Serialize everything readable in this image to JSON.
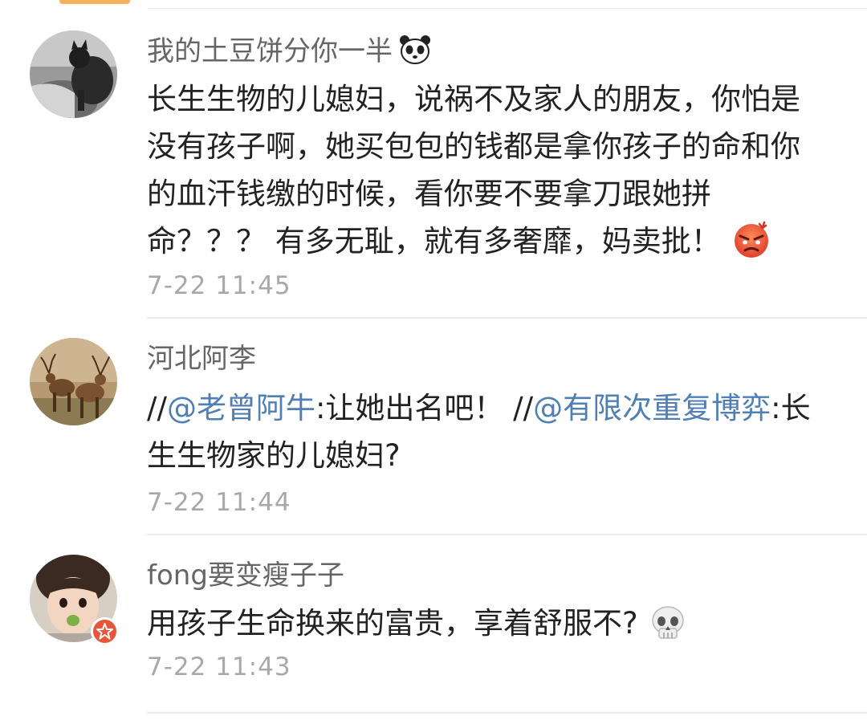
{
  "comments": [
    {
      "username": "我的土豆饼分你一半",
      "username_emoji": "panda-icon",
      "lines": [
        "长生生物的儿媳妇，说祸不及家人的朋友，你怕是",
        "没有孩子啊，她买包包的钱都是拿你孩子的命和你",
        "的血汗钱缴的时候，看你要不要拿刀跟她拼",
        "命？？？ 有多无耻，就有多奢靡，妈卖批！"
      ],
      "content_emoji": "angry-face-icon",
      "time": "7-22 11:45"
    },
    {
      "username": "河北阿李",
      "segments_line1": [
        {
          "text": "//",
          "type": "plain"
        },
        {
          "text": "@老曾阿牛",
          "type": "mention"
        },
        {
          "text": ":让她出名吧！ //",
          "type": "plain"
        },
        {
          "text": "@有限次重复博弈",
          "type": "mention"
        },
        {
          "text": ":长",
          "type": "plain"
        }
      ],
      "line2": "生生物家的儿媳妇?",
      "time": "7-22 11:44"
    },
    {
      "username": "fong要变瘦子子",
      "lines": [
        "用孩子生命换来的富贵，享着舒服不?"
      ],
      "content_emoji": "skull-icon",
      "time": "7-22 11:43"
    }
  ],
  "colors": {
    "username": "#666666",
    "text": "#222222",
    "mention": "#4f7fb4",
    "time": "#a8a8a8",
    "badge": "#e8553b",
    "top_tab": "#f6b15a"
  }
}
